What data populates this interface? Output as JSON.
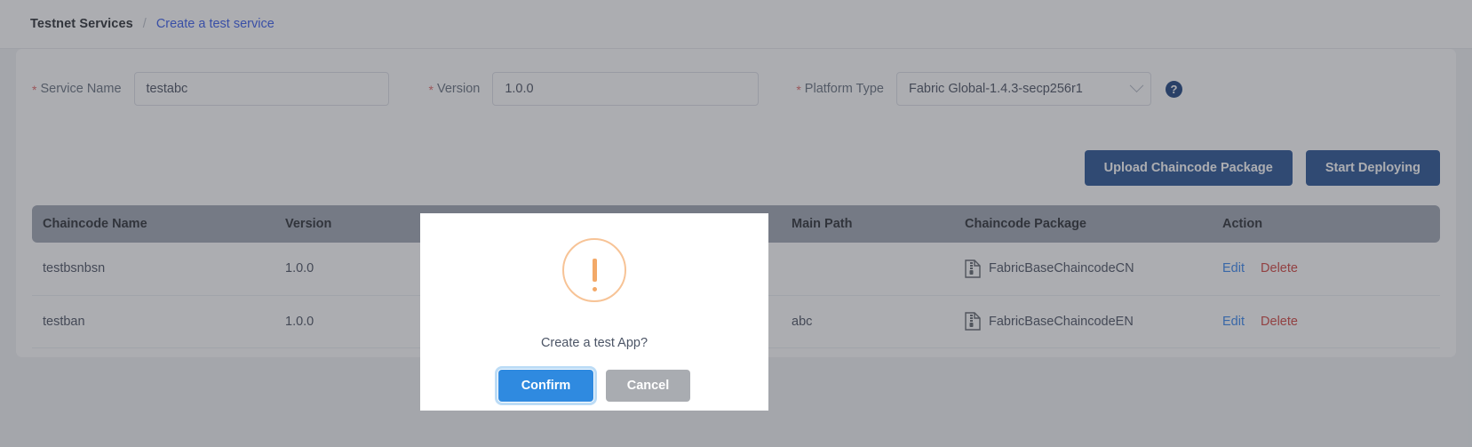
{
  "breadcrumb": {
    "root": "Testnet Services",
    "separator": "/",
    "current": "Create a test service"
  },
  "form": {
    "service_name": {
      "label": "Service Name",
      "value": "testabc",
      "required_marker": "*"
    },
    "version": {
      "label": "Version",
      "value": "1.0.0",
      "required_marker": "*"
    },
    "platform_type": {
      "label": "Platform Type",
      "value": "Fabric Global-1.4.3-secp256r1",
      "required_marker": "*"
    },
    "help_glyph": "?"
  },
  "toolbar": {
    "upload_label": "Upload Chaincode Package",
    "deploy_label": "Start Deploying"
  },
  "table": {
    "headers": [
      "Chaincode Name",
      "Version",
      "",
      "Main Path",
      "Chaincode Package",
      "Action"
    ],
    "rows": [
      {
        "chaincode_name": "testbsnbsn",
        "version": "1.0.0",
        "hidden_col": "",
        "main_path": "",
        "chaincode_package": "FabricBaseChaincodeCN",
        "edit_label": "Edit",
        "delete_label": "Delete"
      },
      {
        "chaincode_name": "testban",
        "version": "1.0.0",
        "hidden_col": "",
        "main_path": "abc",
        "chaincode_package": "FabricBaseChaincodeEN",
        "edit_label": "Edit",
        "delete_label": "Delete"
      }
    ]
  },
  "modal": {
    "message": "Create a test App?",
    "confirm_label": "Confirm",
    "cancel_label": "Cancel",
    "icon": "warning-exclamation-circle-icon"
  },
  "colors": {
    "link": "#2f54eb",
    "primary_button": "#1e4b8f",
    "confirm_button": "#2f8ae0",
    "cancel_button": "#a9acb1",
    "delete_action": "#cf3b36",
    "edit_action": "#2f80ed",
    "warning": "#f3a968",
    "table_header": "#9ba2b0",
    "required_star": "#e06363"
  }
}
